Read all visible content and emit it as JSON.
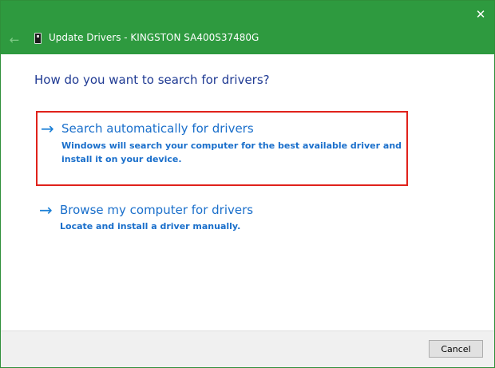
{
  "window": {
    "title": "Update Drivers - KINGSTON SA400S37480G",
    "close_glyph": "✕",
    "back_glyph": "←",
    "accent_color": "#2e9a3f"
  },
  "main": {
    "heading": "How do you want to search for drivers?",
    "options": [
      {
        "arrow": "→",
        "title": "Search automatically for drivers",
        "description": "Windows will search your computer for the best available driver and install it on your device.",
        "highlighted": true
      },
      {
        "arrow": "→",
        "title": "Browse my computer for drivers",
        "description": "Locate and install a driver manually.",
        "highlighted": false
      }
    ]
  },
  "footer": {
    "cancel_label": "Cancel"
  }
}
